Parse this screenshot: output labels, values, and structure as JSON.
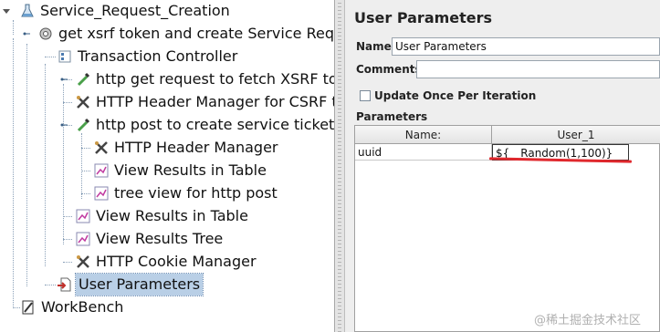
{
  "tree": {
    "root": "Service_Request_Creation",
    "thread_group": "get xsrf token and create Service Reques",
    "transaction_controller": "Transaction Controller",
    "http_get": "http get request to fetch XSRF token",
    "header_mgr_csrf": "HTTP Header Manager for CSRF to",
    "http_post": "http post to create service ticket",
    "post_header_mgr": "HTTP Header Manager",
    "post_view_table": "View Results in Table",
    "post_tree_view": "tree view for http post",
    "view_table": "View Results in Table",
    "view_tree": "View Results Tree",
    "cookie_mgr": "HTTP Cookie Manager",
    "user_params": "User Parameters",
    "workbench": "WorkBench"
  },
  "panel": {
    "title": "User Parameters",
    "name_label": "Name:",
    "name_value": "User Parameters",
    "comments_label": "Comments:",
    "comments_value": "",
    "update_once_label": "Update Once Per Iteration",
    "update_once_checked": false,
    "parameters_label": "Parameters",
    "table": {
      "headers": [
        "Name:",
        "User_1"
      ],
      "rows": [
        [
          "uuid",
          "${__Random(1,100)}"
        ]
      ]
    }
  },
  "watermark": "@稀土掘金技术社区",
  "colors": {
    "selection": "#b9cfe6",
    "annotation_underline": "#e0282d"
  }
}
